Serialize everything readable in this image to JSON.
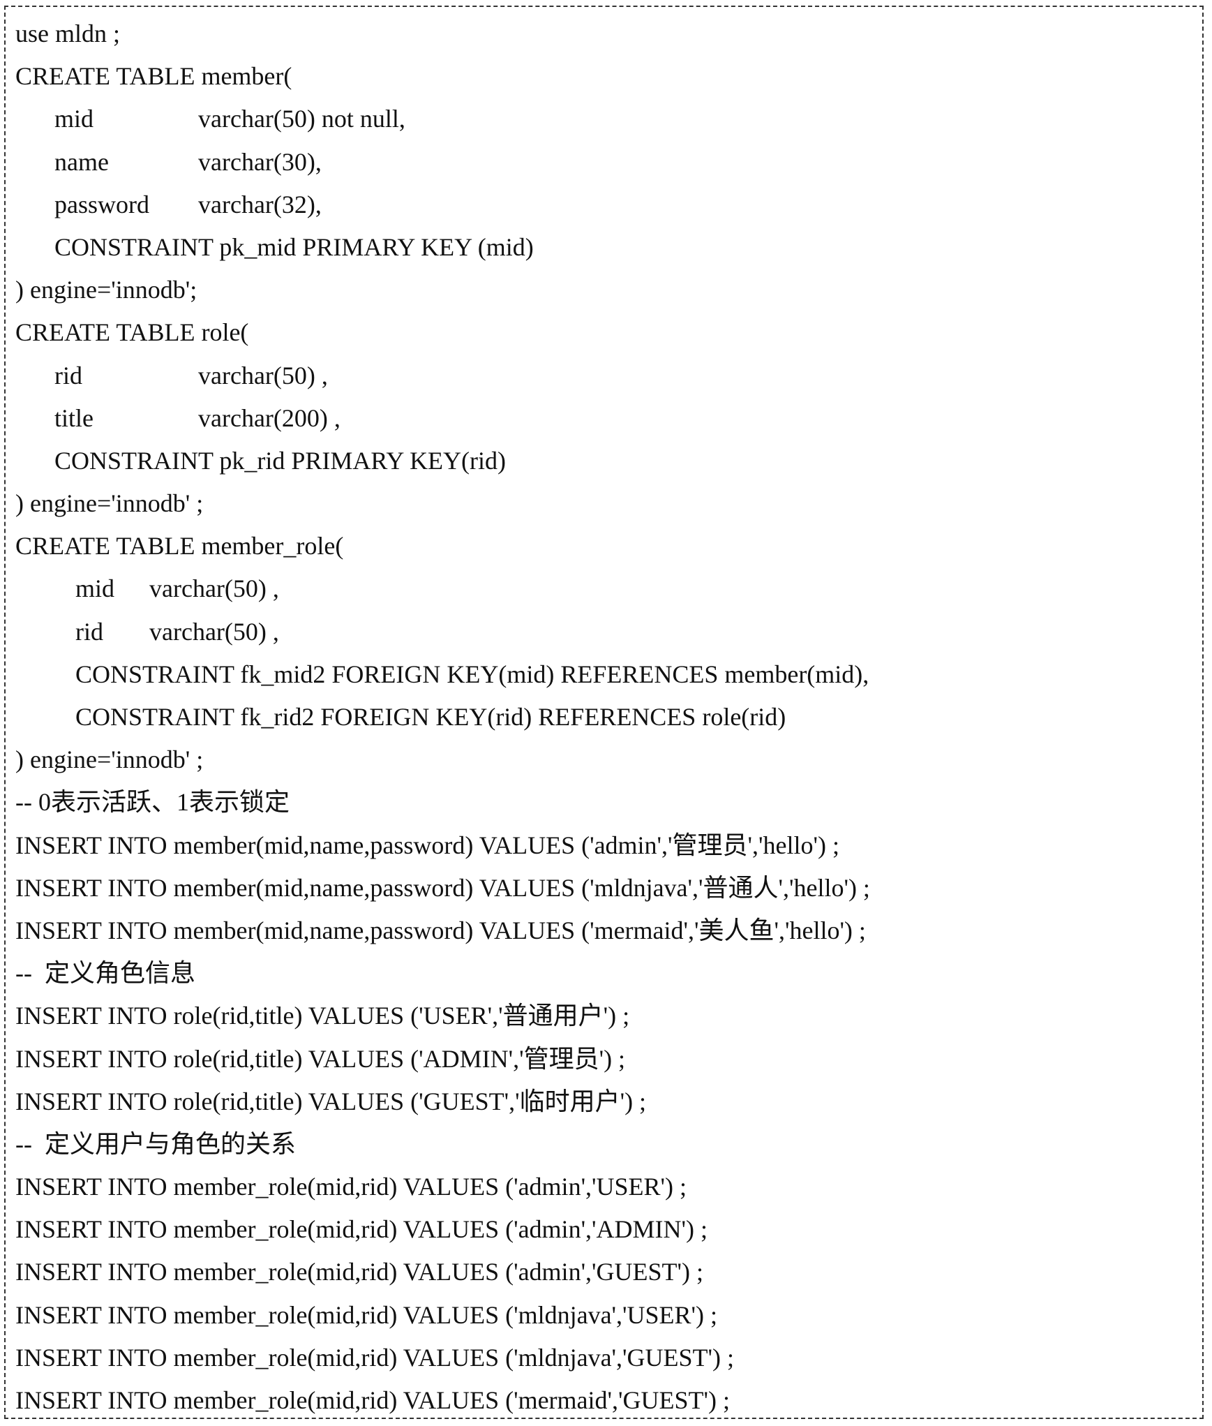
{
  "code": {
    "l01": "use mldn ;",
    "l02": "CREATE TABLE member(",
    "l03_name": "mid",
    "l03_type": "varchar(50) not null,",
    "l04_name": "name",
    "l04_type": "varchar(30),",
    "l05_name": "password",
    "l05_type": "varchar(32),",
    "l06": "CONSTRAINT pk_mid PRIMARY KEY (mid)",
    "l07": ") engine='innodb';",
    "l08": "CREATE TABLE role(",
    "l09_name": "rid",
    "l09_type": "varchar(50) ,",
    "l10_name": "title",
    "l10_type": "varchar(200) ,",
    "l11": "CONSTRAINT pk_rid PRIMARY KEY(rid)",
    "l12": ") engine='innodb' ;",
    "l13": "CREATE TABLE member_role(",
    "l14_name": "mid",
    "l14_type": "varchar(50) ,",
    "l15_name": "rid",
    "l15_type": "varchar(50) ,",
    "l16": "CONSTRAINT fk_mid2 FOREIGN KEY(mid) REFERENCES member(mid),",
    "l17": "CONSTRAINT fk_rid2 FOREIGN KEY(rid) REFERENCES role(rid)",
    "l18": ") engine='innodb' ;",
    "l19": "-- 0表示活跃、1表示锁定",
    "l20": "INSERT INTO member(mid,name,password) VALUES ('admin','管理员','hello') ;",
    "l21": "INSERT INTO member(mid,name,password) VALUES ('mldnjava','普通人','hello') ;",
    "l22": "INSERT INTO member(mid,name,password) VALUES ('mermaid','美人鱼','hello') ;",
    "l23": "--  定义角色信息",
    "l24": "INSERT INTO role(rid,title) VALUES ('USER','普通用户') ;",
    "l25": "INSERT INTO role(rid,title) VALUES ('ADMIN','管理员') ;",
    "l26": "INSERT INTO role(rid,title) VALUES ('GUEST','临时用户') ;",
    "l27": "--  定义用户与角色的关系",
    "l28": "INSERT INTO member_role(mid,rid) VALUES ('admin','USER') ;",
    "l29": "INSERT INTO member_role(mid,rid) VALUES ('admin','ADMIN') ;",
    "l30": "INSERT INTO member_role(mid,rid) VALUES ('admin','GUEST') ;",
    "l31": "INSERT INTO member_role(mid,rid) VALUES ('mldnjava','USER') ;",
    "l32": "INSERT INTO member_role(mid,rid) VALUES ('mldnjava','GUEST') ;",
    "l33": "INSERT INTO member_role(mid,rid) VALUES ('mermaid','GUEST') ;"
  }
}
